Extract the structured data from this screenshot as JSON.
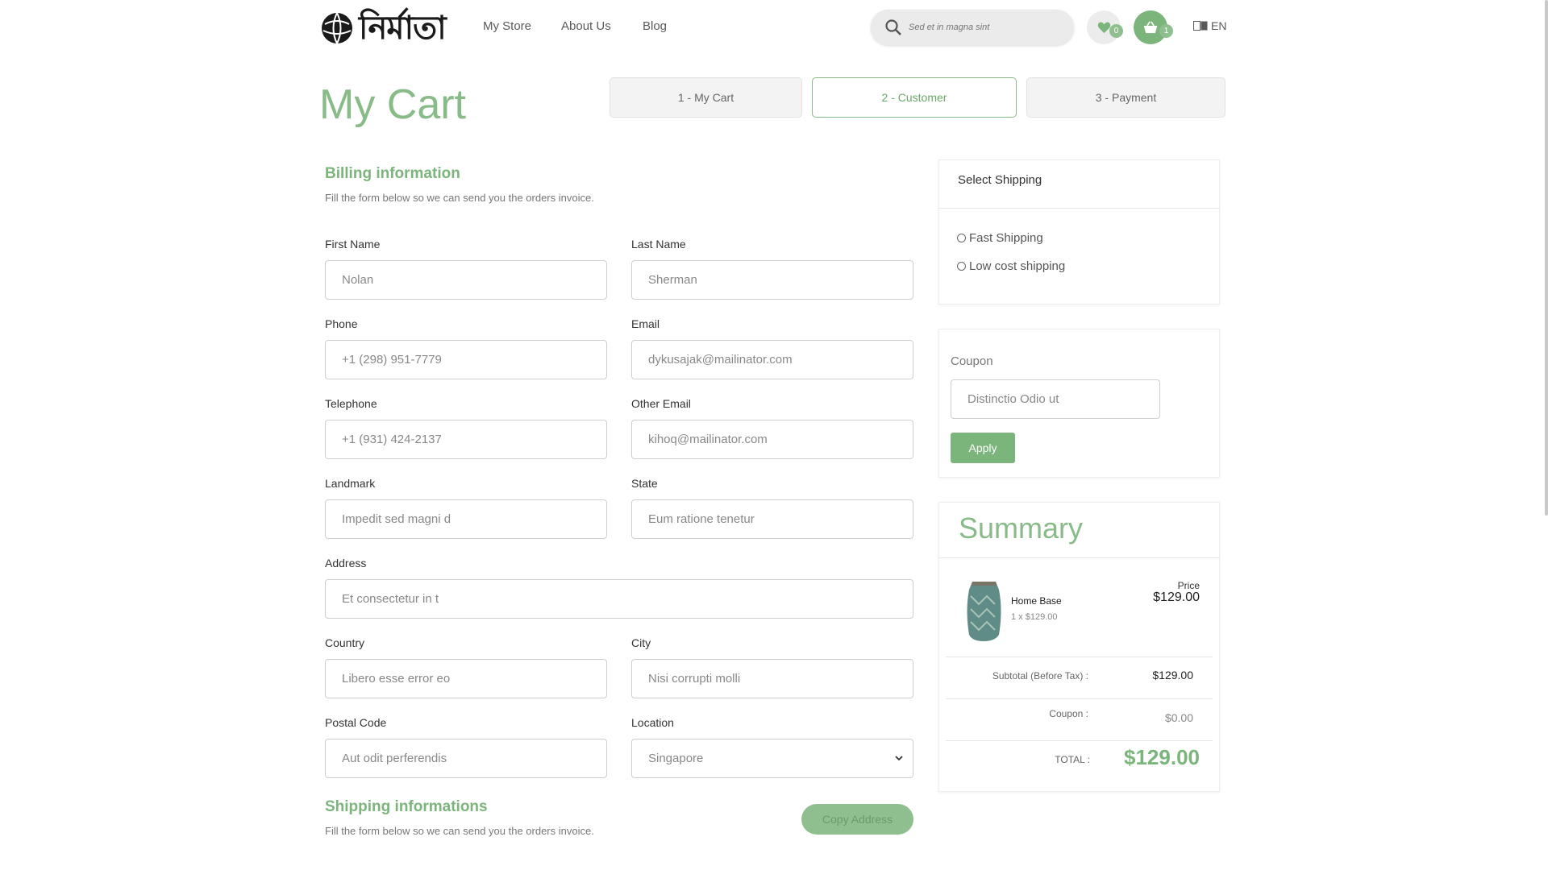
{
  "header": {
    "logo_text": "নির্মাতা",
    "nav": [
      "My Store",
      "About Us",
      "Blog"
    ],
    "search_placeholder": "Sed et in magna sint",
    "wishlist_count": "0",
    "cart_count": "1",
    "language": "EN"
  },
  "page_title": "My Cart",
  "steps": [
    "1 - My Cart",
    "2 - Customer",
    "3 - Payment"
  ],
  "billing": {
    "title": "Billing information",
    "description": "Fill the form below so we can send you the orders invoice.",
    "fields": {
      "first_name": {
        "label": "First Name",
        "value": "Nolan"
      },
      "last_name": {
        "label": "Last Name",
        "value": "Sherman"
      },
      "phone": {
        "label": "Phone",
        "value": "+1 (298) 951-7779"
      },
      "email": {
        "label": "Email",
        "value": "dykusajak@mailinator.com"
      },
      "telephone": {
        "label": "Telephone",
        "value": "+1 (931) 424-2137"
      },
      "other_email": {
        "label": "Other Email",
        "value": "kihoq@mailinator.com"
      },
      "landmark": {
        "label": "Landmark",
        "value": "Impedit sed magni d"
      },
      "state": {
        "label": "State",
        "value": "Eum ratione tenetur"
      },
      "address": {
        "label": "Address",
        "value": "Et consectetur in t"
      },
      "country": {
        "label": "Country",
        "value": "Libero esse error eo"
      },
      "city": {
        "label": "City",
        "value": "Nisi corrupti molli"
      },
      "postal_code": {
        "label": "Postal Code",
        "value": "Aut odit perferendis"
      },
      "location": {
        "label": "Location",
        "value": "Singapore"
      }
    }
  },
  "shipping_info": {
    "title": "Shipping informations",
    "description": "Fill the form below so we can send you the orders invoice.",
    "copy_button": "Copy Address"
  },
  "select_shipping": {
    "title": "Select Shipping",
    "options": [
      "Fast Shipping",
      "Low cost shipping"
    ]
  },
  "coupon": {
    "label": "Coupon",
    "value": "Distinctio Odio ut",
    "apply_button": "Apply"
  },
  "summary": {
    "title": "Summary",
    "item": {
      "name": "Home Base",
      "qty_price": "1 x $129.00",
      "price_label": "Price",
      "price": "$129.00"
    },
    "subtotal_label": "Subtotal (Before Tax) :",
    "subtotal": "$129.00",
    "coupon_label": "Coupon :",
    "coupon_value": "$0.00",
    "total_label": "TOTAL :",
    "total": "$129.00"
  },
  "colors": {
    "accent": "#7bb57b",
    "accent_light": "#8fbe8f"
  }
}
